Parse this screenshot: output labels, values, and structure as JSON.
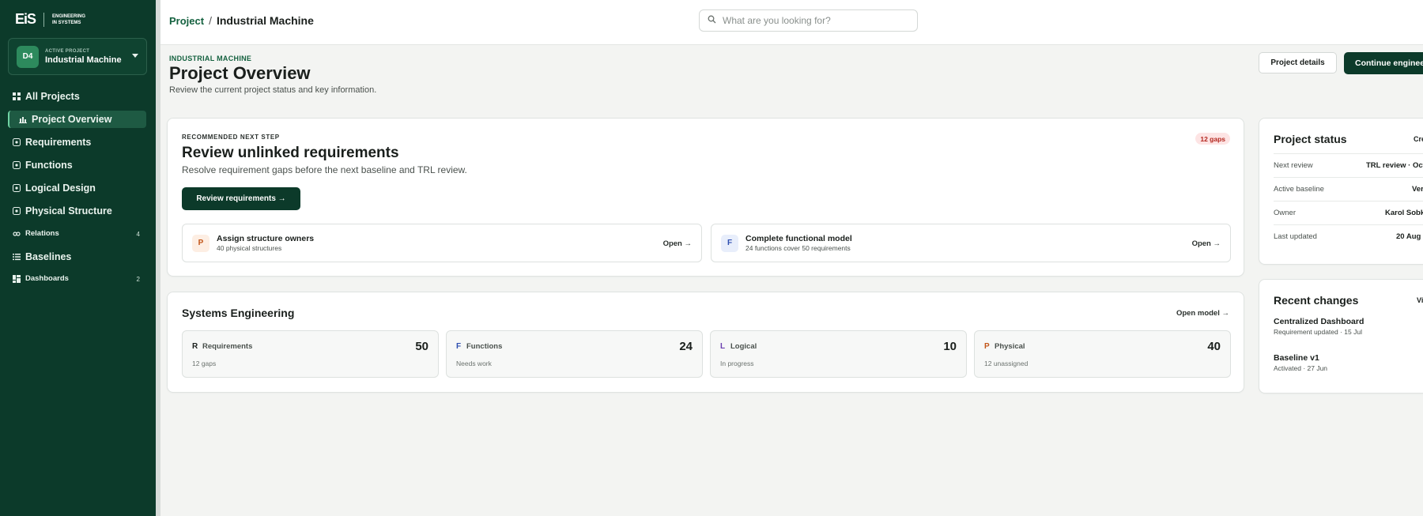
{
  "brand": {
    "logo": "EiS",
    "tagline_line1": "ENGINEERING",
    "tagline_line2": "IN SYSTEMS"
  },
  "project_switcher": {
    "avatar": "D4",
    "label": "ACTIVE PROJECT",
    "name": "Industrial Machine"
  },
  "sidebar": {
    "items": [
      {
        "label": "All Projects",
        "icon": "grid-icon"
      },
      {
        "label": "Project Overview",
        "icon": "chart-icon",
        "active": true
      },
      {
        "label": "Requirements",
        "icon": "square-dot-icon"
      },
      {
        "label": "Functions",
        "icon": "square-dot-icon"
      },
      {
        "label": "Logical Design",
        "icon": "square-dot-icon"
      },
      {
        "label": "Physical Structure",
        "icon": "square-dot-icon"
      },
      {
        "label": "Relations",
        "icon": "link-icon",
        "badge": "4"
      },
      {
        "label": "Baselines",
        "icon": "list-icon"
      },
      {
        "label": "Dashboards",
        "icon": "dashboard-icon",
        "badge": "2"
      }
    ]
  },
  "breadcrumb": {
    "parent": "Project",
    "separator": "/",
    "current": "Industrial Machine"
  },
  "search": {
    "placeholder": "What are you looking for?"
  },
  "page": {
    "eyebrow": "INDUSTRIAL MACHINE",
    "title": "Project Overview",
    "subtitle": "Review the current project status and key information.",
    "details_button": "Project details",
    "continue_button": "Continue engineering"
  },
  "recommendation": {
    "eyebrow": "RECOMMENDED NEXT STEP",
    "title": "Review unlinked requirements",
    "subtitle": "Resolve requirement gaps before the next baseline and TRL review.",
    "badge": "12 gaps",
    "button": "Review requirements →",
    "tasks": [
      {
        "icon_letter": "P",
        "title": "Assign structure owners",
        "subtitle": "40 physical structures",
        "action": "Open →"
      },
      {
        "icon_letter": "F",
        "title": "Complete functional model",
        "subtitle": "24 functions cover 50 requirements",
        "action": "Open →"
      }
    ]
  },
  "systems_engineering": {
    "title": "Systems Engineering",
    "open_link": "Open model →",
    "metrics": [
      {
        "letter": "R",
        "label": "Requirements",
        "value": "50",
        "note": "12 gaps",
        "color": "#1a1f1c"
      },
      {
        "letter": "F",
        "label": "Functions",
        "value": "24",
        "note": "Needs work",
        "color": "#2f4fb0"
      },
      {
        "letter": "L",
        "label": "Logical",
        "value": "10",
        "note": "In progress",
        "color": "#6b3fb0"
      },
      {
        "letter": "P",
        "label": "Physical",
        "value": "40",
        "note": "12 unassigned",
        "color": "#c2561a"
      }
    ]
  },
  "project_status": {
    "title": "Project status",
    "link": "Create",
    "rows": [
      {
        "key": "Next review",
        "value": "TRL review · Oct"
      },
      {
        "key": "Active baseline",
        "value": "Version"
      },
      {
        "key": "Owner",
        "value": "Karol Sobka"
      },
      {
        "key": "Last updated",
        "value": "20 Aug"
      }
    ]
  },
  "recent_changes": {
    "title": "Recent changes",
    "link": "View",
    "items": [
      {
        "title": "Centralized Dashboard",
        "subtitle": "Requirement updated · 15 Jul"
      },
      {
        "title": "Baseline v1",
        "subtitle": "Activated · 27 Jun"
      }
    ]
  }
}
